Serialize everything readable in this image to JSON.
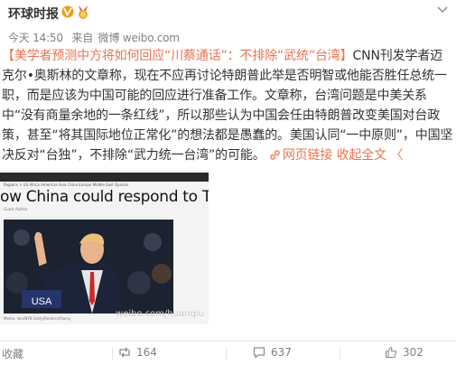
{
  "post": {
    "author": "环球时报",
    "meta": {
      "time": "今天 14:50",
      "from_prefix": "来自",
      "source": "微博 weibo.com"
    },
    "text": {
      "hashtag": "【美学者预测中方将如何回应“川蔡通话”：不排除“武统”台湾】",
      "body": "CNN刊发学者迈克尔•奥斯林的文章称，现在不应再讨论特朗普此举是否明智或他能否胜任总统一职，而是应该为中国可能的回应进行准备工作。文章称，台湾问题是中美关系中“没有商量余地的一条红线”，所以那些认为中国会任由特朗普改变美国对台政策，甚至“将其国际地位正常化”的想法都是愚蠢的。美国认同“一中原则”，中国坚决反对“台独”，不排除“武力统一台湾”的可能。",
      "web_link": "网页链接",
      "expand": "收起全文",
      "expand_arrow": "〈"
    },
    "thumbnail": {
      "headline": "ow China could respond to Trump c",
      "crumbs": "Regions > US   Africa  Americas  Asia  China  Europe  Middle East  Opinion",
      "byline": "Guest Author",
      "badge": "USA",
      "caption": "Media: Van/NYB  Getty/Reuters/Alamy",
      "watermark": "weibo.com/huanqiu"
    },
    "actions": {
      "favorite": "收藏",
      "repost_count": "164",
      "comment_count": "637",
      "like_count": "302"
    }
  },
  "colors": {
    "link": "#eb7350",
    "verified": "#f39c12",
    "meta": "#808080"
  }
}
